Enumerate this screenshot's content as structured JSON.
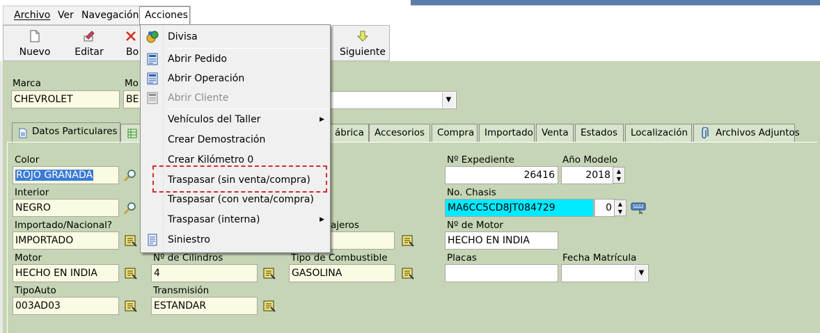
{
  "menubar": {
    "archivo": "Archivo",
    "ver": "Ver",
    "navegacion": "Navegación",
    "acciones": "Acciones"
  },
  "toolbar": {
    "nuevo": "Nuevo",
    "editar": "Editar",
    "borrar_partial": "Bo",
    "siguiente": "Siguiente"
  },
  "header": {
    "marca_label": "Marca",
    "marca_value": "CHEVROLET",
    "modelo_label_partial": "Mo",
    "modelo_value_partial": "BE"
  },
  "tabs": {
    "datos_particulares": "Datos Particulares",
    "fabrica_partial": "ábrica",
    "accesorios": "Accesorios",
    "compra": "Compra",
    "importado": "Importado",
    "venta": "Venta",
    "estados": "Estados",
    "localizacion": "Localización",
    "archivos_adjuntos": "Archivos Adjuntos"
  },
  "fields": {
    "color_label": "Color",
    "color_value": "ROJO GRANADA",
    "interior_label": "Interior",
    "interior_value": "NEGRO",
    "importado_label": "Importado/Nacional?",
    "importado_value": "IMPORTADO",
    "motor_label": "Motor",
    "motor_value": "HECHO EN INDIA",
    "tipoauto_label": "TipoAuto",
    "tipoauto_value": "003AD03",
    "cilindros_label": "Nº de Cilindros",
    "cilindros_value": "4",
    "transmision_label": "Transmisión",
    "transmision_value": "ESTANDAR",
    "pasajeros_label_partial": "ajeros",
    "combustible_label": "Tipo de Combustible",
    "combustible_value": "GASOLINA",
    "expediente_label": "Nº Expediente",
    "expediente_value": "26416",
    "anio_label": "Año Modelo",
    "anio_value": "2018",
    "chasis_label": "No. Chasis",
    "chasis_value": "MA6CC5CD8JT084729",
    "chasis_spin": "0",
    "nmotor_label": "Nº de Motor",
    "nmotor_value": "HECHO EN INDIA",
    "placas_label": "Placas",
    "placas_value": "",
    "fecha_label": "Fecha Matrícula",
    "fecha_value": ""
  },
  "dropdown": {
    "divisa": "Divisa",
    "abrir_pedido": "Abrir Pedido",
    "abrir_operacion": "Abrir Operación",
    "abrir_cliente": "Abrir Cliente",
    "vehiculos_taller": "Vehículos del Taller",
    "crear_demostracion": "Crear Demostración",
    "crear_km0": "Crear Kilómetro 0",
    "traspasar_sin": "Traspasar (sin venta/compra)",
    "traspasar_con": "Traspasar (con venta/compra)",
    "traspasar_interna": "Traspasar (interna)",
    "siniestro": "Siniestro"
  },
  "colors": {
    "panel_bg": "#c6d5b5",
    "field_bg": "#fbfae3",
    "highlight": "#d62b2b",
    "chasis_bg": "#00eaff"
  }
}
